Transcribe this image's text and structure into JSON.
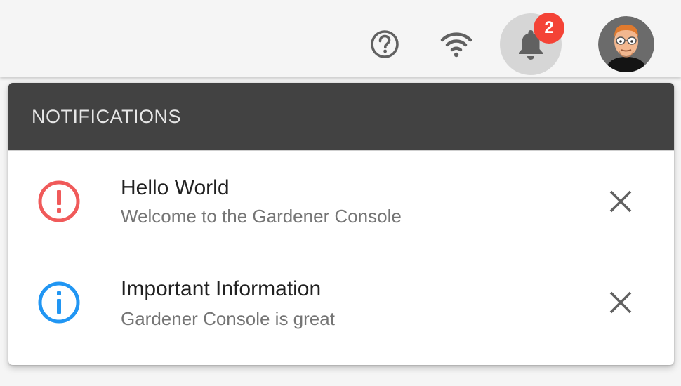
{
  "toolbar": {
    "icons": {
      "help": "help-circle-icon",
      "wifi": "wifi-icon",
      "bell": "bell-icon",
      "avatar": "avatar"
    },
    "notification_count": "2",
    "badge_color": "#f44336"
  },
  "menu": {
    "header": "NOTIFICATIONS",
    "items": [
      {
        "title": "Hello World",
        "subtitle": "Welcome to the Gardener Console",
        "icon": "alert-circle-icon",
        "icon_color": "#f05a5a"
      },
      {
        "title": "Important Information",
        "subtitle": "Gardener Console is great",
        "icon": "info-circle-icon",
        "icon_color": "#2196f3"
      }
    ]
  }
}
